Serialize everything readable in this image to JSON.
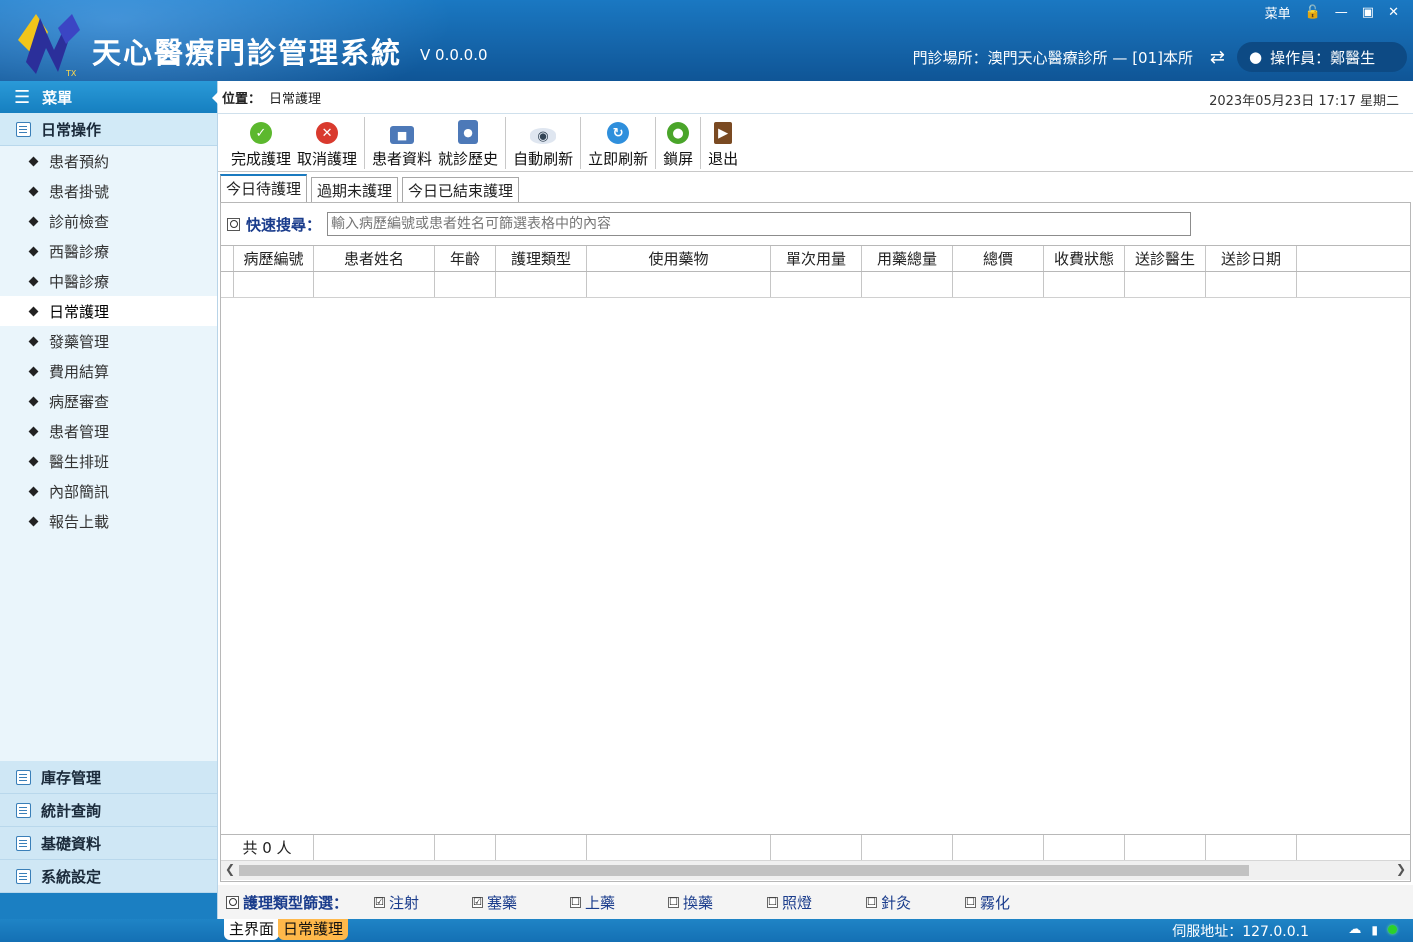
{
  "window": {
    "title": "天心醫療門診管理系統",
    "version": "V 0.0.0.0",
    "menu_label": "菜单",
    "clinic": "門診場所：澳門天心醫療診所 — [01]本所",
    "operator": "操作員：鄭醫生"
  },
  "sidebar": {
    "menu_title": "菜單",
    "group_active": "日常操作",
    "items": [
      {
        "label": "患者預約"
      },
      {
        "label": "患者掛號"
      },
      {
        "label": "診前檢查"
      },
      {
        "label": "西醫診療"
      },
      {
        "label": "中醫診療"
      },
      {
        "label": "日常護理"
      },
      {
        "label": "發藥管理"
      },
      {
        "label": "費用結算"
      },
      {
        "label": "病歷審查"
      },
      {
        "label": "患者管理"
      },
      {
        "label": "醫生排班"
      },
      {
        "label": "內部簡訊"
      },
      {
        "label": "報告上載"
      }
    ],
    "active_index": 5,
    "bottom_groups": [
      {
        "label": "庫存管理"
      },
      {
        "label": "統計查詢"
      },
      {
        "label": "基礎資料"
      },
      {
        "label": "系統設定"
      }
    ]
  },
  "location": {
    "label": "位置：",
    "value": "日常護理",
    "datetime": "2023年05月23日 17:17  星期二"
  },
  "toolbar": {
    "complete": "完成護理",
    "cancel": "取消護理",
    "patient_info": "患者資料",
    "visit_history": "就診歷史",
    "auto_refresh": "自動刷新",
    "refresh_now": "立即刷新",
    "lock": "鎖屏",
    "exit": "退出"
  },
  "tabs": [
    {
      "label": "今日待護理"
    },
    {
      "label": "過期未護理"
    },
    {
      "label": "今日已結束護理"
    }
  ],
  "search": {
    "label": "快速搜尋：",
    "placeholder": "輸入病歷編號或患者姓名可篩選表格中的內容"
  },
  "table": {
    "columns": [
      "病歷編號",
      "患者姓名",
      "年齡",
      "護理類型",
      "使用藥物",
      "單次用量",
      "用藥總量",
      "總價",
      "收費狀態",
      "送診醫生",
      "送診日期"
    ],
    "footer_count": "共 0 人"
  },
  "filter": {
    "label": "護理類型篩選：",
    "options": [
      {
        "label": "注射",
        "checked": "☑"
      },
      {
        "label": "塞藥",
        "checked": "☑"
      },
      {
        "label": "上藥",
        "checked": "☐"
      },
      {
        "label": "換藥",
        "checked": "☐"
      },
      {
        "label": "照燈",
        "checked": "☐"
      },
      {
        "label": "針灸",
        "checked": "☐"
      },
      {
        "label": "霧化",
        "checked": "☐"
      }
    ]
  },
  "statusbar": {
    "tab_main": "主界面",
    "tab_current": "日常護理",
    "server": "伺服地址：127.0.0.1"
  },
  "colors": {
    "titlebar": "#1565aa",
    "sidebar_bg": "#eaf5fb",
    "accent_tab": "#ffb84a",
    "label_blue": "#1a3c8c"
  }
}
